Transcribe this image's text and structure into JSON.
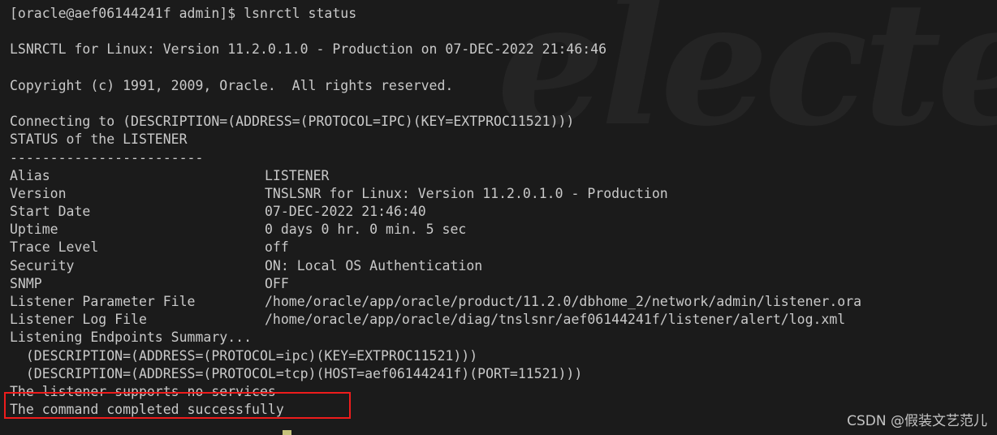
{
  "terminal": {
    "app_watermark": "electerm",
    "csdn_watermark": "CSDN @假装文艺范儿",
    "prompt": "[oracle@aef06144241f admin]$ ",
    "command": "lsnrctl status",
    "colors": {
      "background": "#1b1b1b",
      "foreground": "#c9c9c9",
      "annotation": "#ee1c1c",
      "cursor": "#c5c17a",
      "watermark": "#242424"
    },
    "lines": {
      "prompt_line": "[oracle@aef06144241f admin]$ lsnrctl status",
      "banner": "LSNRCTL for Linux: Version 11.2.0.1.0 - Production on 07-DEC-2022 21:46:46",
      "copyright": "Copyright (c) 1991, 2009, Oracle.  All rights reserved.",
      "connecting": "Connecting to (DESCRIPTION=(ADDRESS=(PROTOCOL=IPC)(KEY=EXTPROC11521)))",
      "status_header": "STATUS of the LISTENER",
      "separator": "------------------------",
      "endpoints_header": "Listening Endpoints Summary...",
      "endpoint_ipc": "  (DESCRIPTION=(ADDRESS=(PROTOCOL=ipc)(KEY=EXTPROC11521)))",
      "endpoint_tcp": "  (DESCRIPTION=(ADDRESS=(PROTOCOL=tcp)(HOST=aef06144241f)(PORT=11521)))",
      "no_services": "The listener supports no services",
      "completed": "The command completed successfully"
    },
    "status_table": [
      {
        "key": "Alias",
        "value": "LISTENER"
      },
      {
        "key": "Version",
        "value": "TNSLSNR for Linux: Version 11.2.0.1.0 - Production"
      },
      {
        "key": "Start Date",
        "value": "07-DEC-2022 21:46:40"
      },
      {
        "key": "Uptime",
        "value": "0 days 0 hr. 0 min. 5 sec"
      },
      {
        "key": "Trace Level",
        "value": "off"
      },
      {
        "key": "Security",
        "value": "ON: Local OS Authentication"
      },
      {
        "key": "SNMP",
        "value": "OFF"
      },
      {
        "key": "Listener Parameter File",
        "value": "/home/oracle/app/oracle/product/11.2.0/dbhome_2/network/admin/listener.ora"
      },
      {
        "key": "Listener Log File",
        "value": "/home/oracle/app/oracle/diag/tnslsnr/aef06144241f/listener/alert/log.xml"
      }
    ]
  }
}
